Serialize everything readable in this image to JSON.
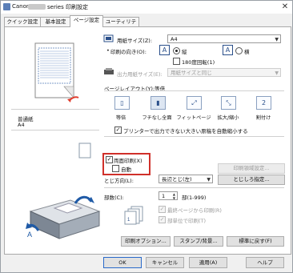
{
  "window": {
    "title_prefix": "Canon",
    "title_suffix": "series 印刷設定",
    "close_label": "✕"
  },
  "tabs": [
    {
      "label": "クイック設定"
    },
    {
      "label": "基本設定"
    },
    {
      "label": "ページ設定"
    },
    {
      "label": "ユーティリティ"
    }
  ],
  "left": {
    "media_type": "普通紙",
    "paper_size": "A4"
  },
  "page": {
    "paper_size_label": "用紙サイズ(Z):",
    "paper_size_value": "A4",
    "orientation_label": "印刷の向き(O):",
    "portrait_label": "縦",
    "landscape_label": "横",
    "rotate_label": "180度回転(1)",
    "output_size_label": "出力用紙サイズ(E):",
    "output_size_value": "用紙サイズと同じ",
    "layout_group_label": "ページレイアウト(Y):等倍",
    "layouts": [
      {
        "label": "等倍"
      },
      {
        "label": "フチなし全面"
      },
      {
        "label": "フィットページ"
      },
      {
        "label": "拡大/縮小"
      },
      {
        "label": "割付け"
      }
    ],
    "auto_reduce_label": "プリンターで出力できない大きい原稿を自動縮小する",
    "duplex_label": "両面印刷(X)",
    "auto_label": "自動",
    "duplex_area_button": "印刷領域設定...",
    "binding_label": "とじ方向(L):",
    "binding_value": "長辺とじ(左)",
    "margin_button": "とじしろ指定...",
    "copies_label": "部数(C):",
    "copies_value": "1",
    "copies_range": "部(1-999)",
    "last_page_label": "最終ページから印刷(R)",
    "collate_label": "部単位で印刷(T)",
    "print_options_button": "印刷オプション...",
    "stamp_button": "スタンプ/背景...",
    "defaults_button": "標準に戻す(F)"
  },
  "footer": {
    "ok": "OK",
    "cancel": "キャンセル",
    "apply": "適用(A)",
    "help": "ヘルプ"
  },
  "colors": {
    "highlight_border": "#d0302a",
    "accent": "#2a4f8a"
  }
}
